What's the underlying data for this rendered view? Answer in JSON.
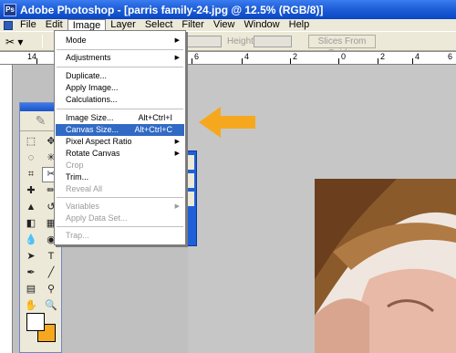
{
  "window": {
    "app_icon_text": "Ps",
    "title": "Adobe Photoshop - [parris family-24.jpg @ 12.5% (RGB/8)]"
  },
  "menubar": {
    "items": [
      "File",
      "Edit",
      "Image",
      "Layer",
      "Select",
      "Filter",
      "View",
      "Window",
      "Help"
    ]
  },
  "optionsbar": {
    "height_label": "Height:",
    "slices_button": "Slices From Guides"
  },
  "ruler": {
    "labels": [
      "14",
      "6",
      "4",
      "2",
      "0",
      "2",
      "4",
      "6"
    ]
  },
  "image_menu": {
    "mode": "Mode",
    "adjustments": "Adjustments",
    "duplicate": "Duplicate...",
    "apply_image": "Apply Image...",
    "calculations": "Calculations...",
    "image_size": "Image Size...",
    "image_size_shortcut": "Alt+Ctrl+I",
    "canvas_size": "Canvas Size...",
    "canvas_size_shortcut": "Alt+Ctrl+C",
    "pixel_aspect_ratio": "Pixel Aspect Ratio",
    "rotate_canvas": "Rotate Canvas",
    "crop": "Crop",
    "trim": "Trim...",
    "reveal_all": "Reveal All",
    "variables": "Variables",
    "apply_data_set": "Apply Data Set...",
    "trap": "Trap..."
  },
  "colors": {
    "highlight": "#316ac5",
    "annotation_arrow": "#f5a81e",
    "background_swatch": "#f5a81e",
    "foreground_swatch": "#ffffff"
  }
}
